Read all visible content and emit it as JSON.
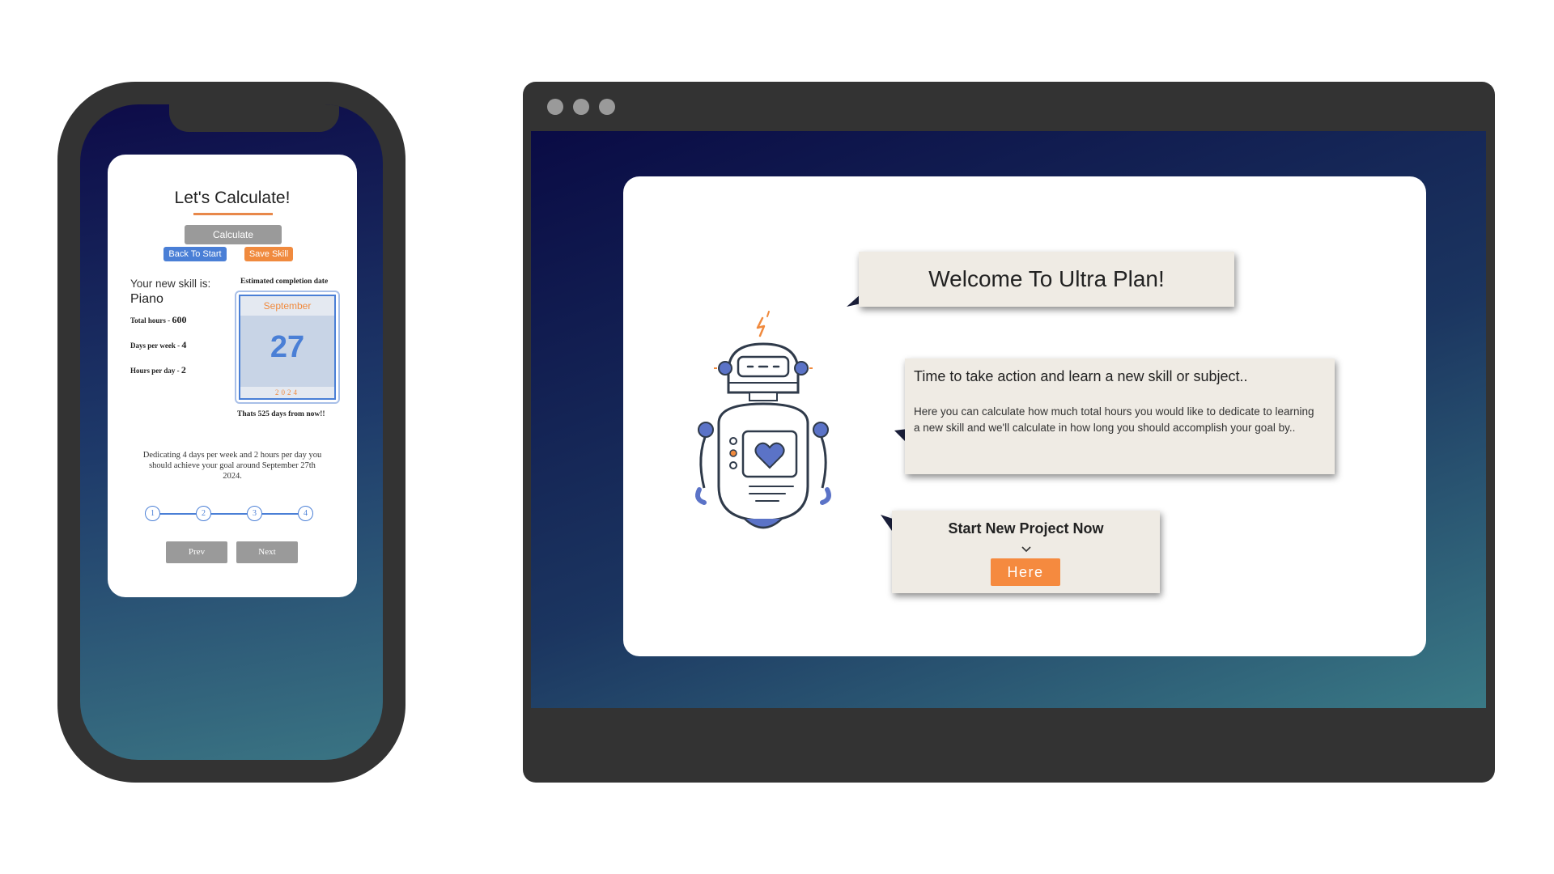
{
  "mobile": {
    "title": "Let's Calculate!",
    "calculate_label": "Calculate",
    "back_label": "Back To Start",
    "save_label": "Save Skill",
    "skill_label": "Your new skill is:",
    "skill_name": "Piano",
    "stats": [
      {
        "label": "Total hours - ",
        "value": "600"
      },
      {
        "label": "Days per week - ",
        "value": "4"
      },
      {
        "label": "Hours per day - ",
        "value": "2"
      }
    ],
    "estimated_label": "Estimated completion date",
    "calendar": {
      "month": "September",
      "day": "27",
      "year": "2024"
    },
    "days_from_now": "Thats 525 days from now!!",
    "summary": "Dedicating 4 days per week and 2 hours per day you should achieve your goal around September 27th 2024.",
    "steps": [
      "1",
      "2",
      "3",
      "4"
    ],
    "prev_label": "Prev",
    "next_label": "Next"
  },
  "desktop": {
    "welcome": "Welcome To Ultra Plan!",
    "info_heading": "Time to take action and learn a new skill or subject..",
    "info_body": "Here you can calculate how much total hours you would like to dedicate to learning a new skill and we'll calculate in how long you should accomplish your goal by..",
    "cta_title": "Start New Project Now",
    "cta_button": "Here"
  },
  "colors": {
    "orange": "#f58a3f",
    "blue": "#4a7fd6",
    "bubble": "#efebe4",
    "frame": "#333333"
  },
  "icons": [
    "robot-illustration",
    "chevron-down-icon",
    "window-dot-icon"
  ]
}
